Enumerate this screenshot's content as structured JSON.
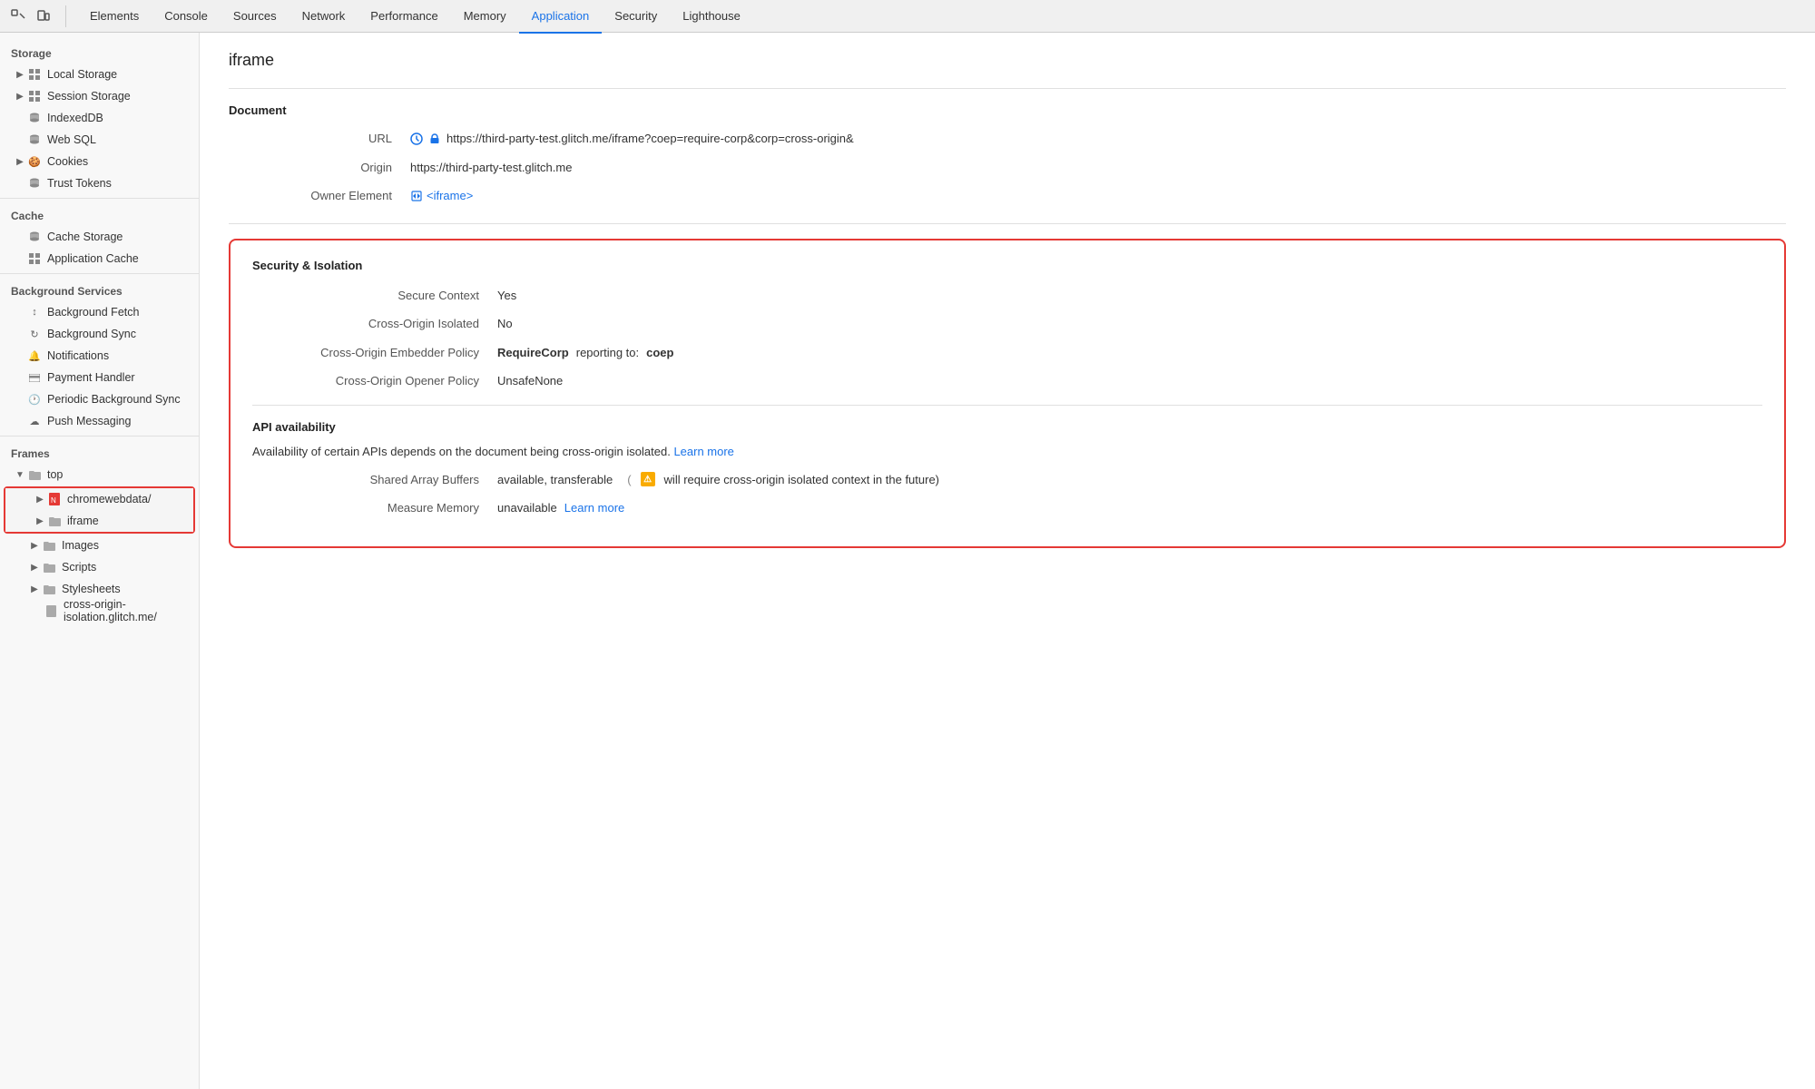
{
  "tabs": {
    "items": [
      {
        "label": "Elements",
        "active": false
      },
      {
        "label": "Console",
        "active": false
      },
      {
        "label": "Sources",
        "active": false
      },
      {
        "label": "Network",
        "active": false
      },
      {
        "label": "Performance",
        "active": false
      },
      {
        "label": "Memory",
        "active": false
      },
      {
        "label": "Application",
        "active": true
      },
      {
        "label": "Security",
        "active": false
      },
      {
        "label": "Lighthouse",
        "active": false
      }
    ]
  },
  "sidebar": {
    "storage_label": "Storage",
    "cache_label": "Cache",
    "bg_services_label": "Background Services",
    "frames_label": "Frames",
    "storage_items": [
      {
        "label": "Local Storage",
        "icon": "grid",
        "expandable": true
      },
      {
        "label": "Session Storage",
        "icon": "grid",
        "expandable": true
      },
      {
        "label": "IndexedDB",
        "icon": "cylinder",
        "expandable": false
      },
      {
        "label": "Web SQL",
        "icon": "cylinder",
        "expandable": false
      },
      {
        "label": "Cookies",
        "icon": "cookie",
        "expandable": true
      },
      {
        "label": "Trust Tokens",
        "icon": "cylinder",
        "expandable": false
      }
    ],
    "cache_items": [
      {
        "label": "Cache Storage",
        "icon": "cylinder",
        "expandable": false
      },
      {
        "label": "Application Cache",
        "icon": "grid",
        "expandable": false
      }
    ],
    "bg_services_items": [
      {
        "label": "Background Fetch",
        "icon": "arrows",
        "expandable": false
      },
      {
        "label": "Background Sync",
        "icon": "sync",
        "expandable": false
      },
      {
        "label": "Notifications",
        "icon": "bell",
        "expandable": false
      },
      {
        "label": "Payment Handler",
        "icon": "card",
        "expandable": false
      },
      {
        "label": "Periodic Background Sync",
        "icon": "clock",
        "expandable": false
      },
      {
        "label": "Push Messaging",
        "icon": "cloud",
        "expandable": false
      }
    ],
    "frames_items": [
      {
        "label": "top",
        "icon": "folder",
        "expandable": true,
        "level": 0
      },
      {
        "label": "chromewebdata/",
        "icon": "red-file",
        "expandable": true,
        "level": 1,
        "selected": true
      },
      {
        "label": "iframe",
        "icon": "folder-sm",
        "expandable": true,
        "level": 1,
        "selected": true
      },
      {
        "label": "Images",
        "icon": "folder",
        "expandable": true,
        "level": 1
      },
      {
        "label": "Scripts",
        "icon": "folder",
        "expandable": true,
        "level": 1
      },
      {
        "label": "Stylesheets",
        "icon": "folder",
        "expandable": true,
        "level": 1
      },
      {
        "label": "cross-origin-isolation.glitch.me/",
        "icon": "file-sm",
        "expandable": false,
        "level": 2
      }
    ]
  },
  "content": {
    "page_title": "iframe",
    "document_section": {
      "title": "Document",
      "rows": [
        {
          "label": "URL",
          "value": "https://third-party-test.glitch.me/iframe?coep=require-corp&corp=cross-origin&",
          "type": "url"
        },
        {
          "label": "Origin",
          "value": "https://third-party-test.glitch.me",
          "type": "text"
        },
        {
          "label": "Owner Element",
          "value": "<iframe>",
          "type": "link"
        }
      ]
    },
    "security_section": {
      "title": "Security & Isolation",
      "rows": [
        {
          "label": "Secure Context",
          "value": "Yes"
        },
        {
          "label": "Cross-Origin Isolated",
          "value": "No"
        },
        {
          "label": "Cross-Origin Embedder Policy",
          "value": "RequireCorp",
          "extra": "reporting to:",
          "extra_value": "coep"
        },
        {
          "label": "Cross-Origin Opener Policy",
          "value": "UnsafeNone"
        }
      ]
    },
    "api_section": {
      "title": "API availability",
      "description": "Availability of certain APIs depends on the document being cross-origin isolated.",
      "learn_more_label": "Learn more",
      "learn_more_url": "#",
      "rows": [
        {
          "label": "Shared Array Buffers",
          "value": "available, transferable",
          "warning": "⚠",
          "warning_note": "will require cross-origin isolated context in the future)"
        },
        {
          "label": "Measure Memory",
          "value": "unavailable",
          "learn_more_label": "Learn more",
          "learn_more_url": "#"
        }
      ]
    }
  }
}
